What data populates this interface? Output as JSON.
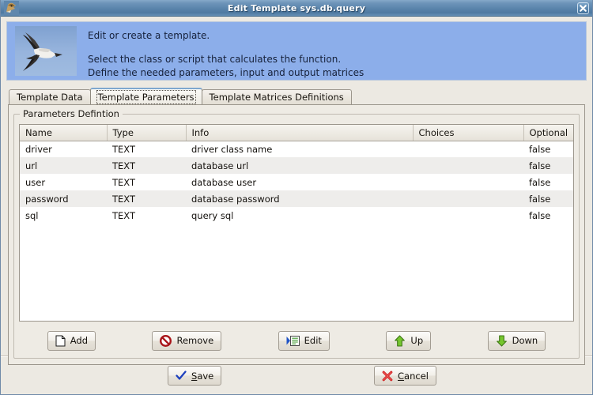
{
  "window": {
    "title": "Edit Template sys.db.query",
    "icon": "eagle-head-icon",
    "close_label": "×"
  },
  "banner": {
    "image": "flying-hawk-photo",
    "line1": "Edit or create a template.",
    "line2": "Select the class or script that calculates the function.",
    "line3": "Define the needed parameters, input and output matrices",
    "background_color": "#8caeea"
  },
  "tabs": [
    {
      "label": "Template Data",
      "selected": false
    },
    {
      "label": "Template Parameters",
      "selected": true
    },
    {
      "label": "Template Matrices Definitions",
      "selected": false
    }
  ],
  "group": {
    "title": "Parameters Defintion"
  },
  "table": {
    "columns": [
      "Name",
      "Type",
      "Info",
      "Choices",
      "Optional"
    ],
    "rows": [
      {
        "name": "driver",
        "type": "TEXT",
        "info": "driver class name",
        "choices": "",
        "optional": "false"
      },
      {
        "name": "url",
        "type": "TEXT",
        "info": "database url",
        "choices": "",
        "optional": "false"
      },
      {
        "name": "user",
        "type": "TEXT",
        "info": "database user",
        "choices": "",
        "optional": "false"
      },
      {
        "name": "password",
        "type": "TEXT",
        "info": "database password",
        "choices": "",
        "optional": "false"
      },
      {
        "name": "sql",
        "type": "TEXT",
        "info": "query sql",
        "choices": "",
        "optional": "false"
      }
    ]
  },
  "toolbar": {
    "add_label": "Add",
    "remove_label": "Remove",
    "edit_label": "Edit",
    "up_label": "Up",
    "down_label": "Down"
  },
  "footer": {
    "save_label": "Save",
    "save_mnemonic": "S",
    "save_rest": "ave",
    "cancel_label": "Cancel",
    "cancel_mnemonic": "C",
    "cancel_rest": "ancel"
  },
  "colors": {
    "titlebar": "#5b85ac",
    "banner": "#8caeea",
    "dialog": "#ece9e2",
    "panel": "#eeebe4",
    "row_alt": "#eeedeb",
    "green_arrow": "#6cbe2a",
    "red_icon": "#b41d22",
    "blue_check": "#1e46c8"
  }
}
